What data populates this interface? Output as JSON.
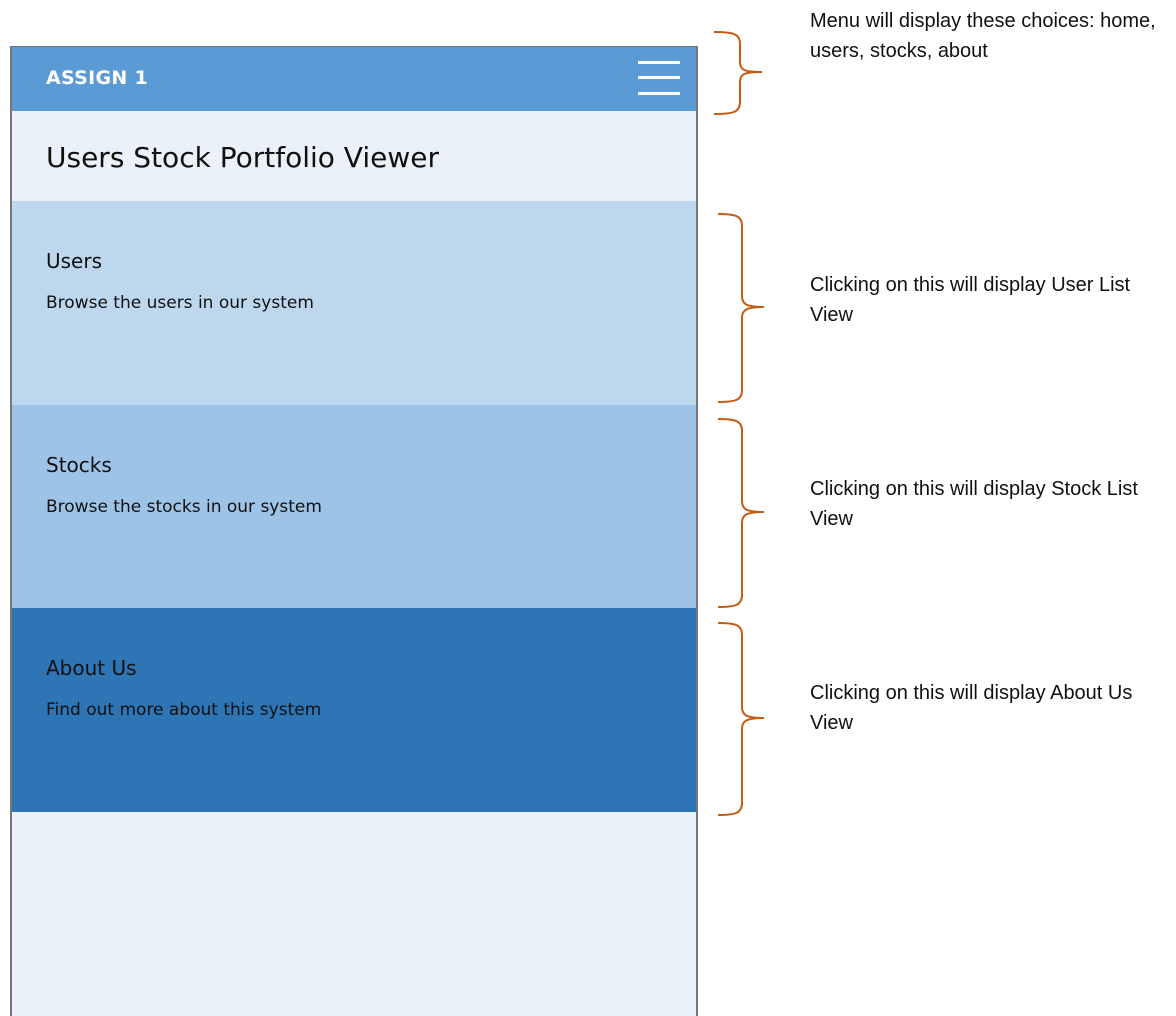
{
  "appbar": {
    "title": "ASSIGN 1",
    "menu_icon": "hamburger-menu-icon"
  },
  "page": {
    "heading": "Users Stock Portfolio Viewer"
  },
  "cards": [
    {
      "title": "Users",
      "description": "Browse the users in our system"
    },
    {
      "title": "Stocks",
      "description": "Browse the stocks in our system"
    },
    {
      "title": "About Us",
      "description": "Find out more about this system"
    }
  ],
  "annotations": {
    "menu": "Menu will display these choices: home, users, stocks, about",
    "users": "Clicking on this will display User List View",
    "stocks": "Clicking on this will display Stock List View",
    "about": "Clicking on this will display About Us View"
  },
  "colors": {
    "appbar": "#5b9bd5",
    "background": "#eaf1f8",
    "card_users": "#bdd7ee",
    "card_stocks": "#9dc3e6",
    "card_about": "#2e75b6",
    "brace": "#c55a11"
  }
}
